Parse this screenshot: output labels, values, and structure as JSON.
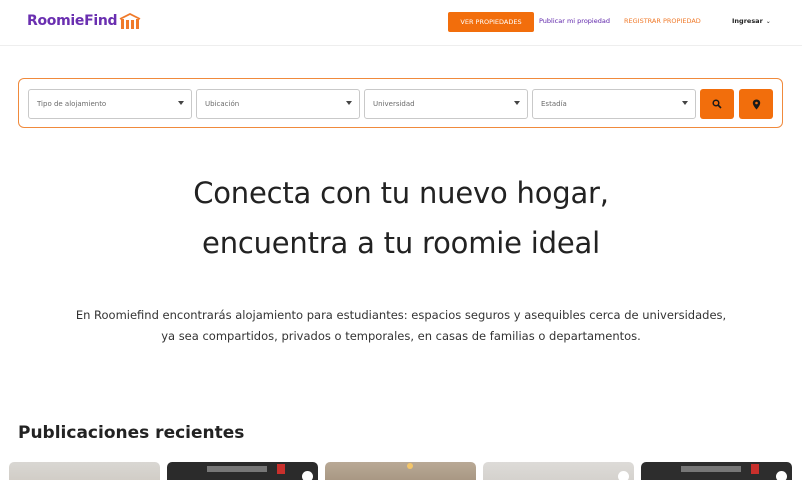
{
  "header": {
    "logo_text": "RoomieFind",
    "ver_propiedades": "VER PROPIEDADES",
    "publicar": "Publicar mi propiedad",
    "registrar": "REGISTRAR PROPIEDAD",
    "ingresar": "Ingresar",
    "ingresar_chevron": "⌄"
  },
  "search": {
    "tipo": "Tipo de alojamiento",
    "ubicacion": "Ubicación",
    "universidad": "Universidad",
    "estadia": "Estadía"
  },
  "hero": {
    "title_line1": "Conecta con tu nuevo hogar,",
    "title_line2": "encuentra a tu roomie ideal",
    "desc_line1": "En Roomiefind encontrarás alojamiento para estudiantes: espacios seguros y asequibles cerca de universidades,",
    "desc_line2": "ya sea compartidos, privados o temporales, en casas de familias o departamentos."
  },
  "recent": {
    "title": "Publicaciones recientes"
  },
  "colors": {
    "brand_purple": "#6a2fb0",
    "accent_orange": "#f26e0c"
  },
  "icons": {
    "logo": "house-logo-icon",
    "search": "search-icon",
    "location": "location-pin-icon",
    "dropdown": "caret-down-icon",
    "favorite": "heart-icon"
  }
}
